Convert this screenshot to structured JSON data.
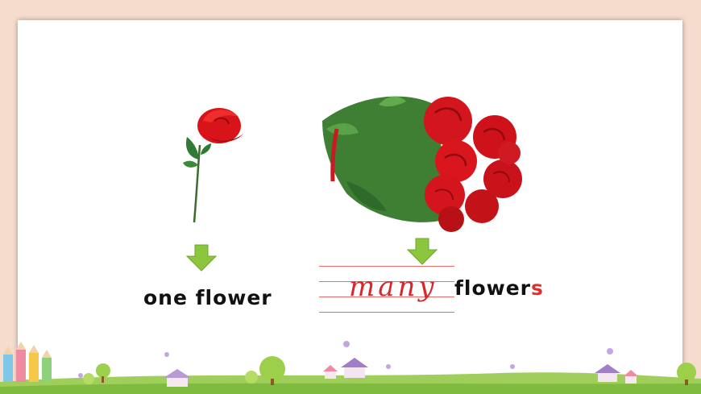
{
  "slide": {
    "single": {
      "label": "one flower"
    },
    "plural": {
      "quantifier": "many",
      "word_stem": "flower",
      "word_suffix": "s"
    }
  },
  "colors": {
    "background": "#f6dccd",
    "card": "#ffffff",
    "highlight_red": "#e0302c",
    "arrow_green": "#8cc63e"
  },
  "icons": [
    "rose-icon",
    "bouquet-icon",
    "down-arrow-icon",
    "pencil-icon",
    "house-icon",
    "tree-icon"
  ]
}
